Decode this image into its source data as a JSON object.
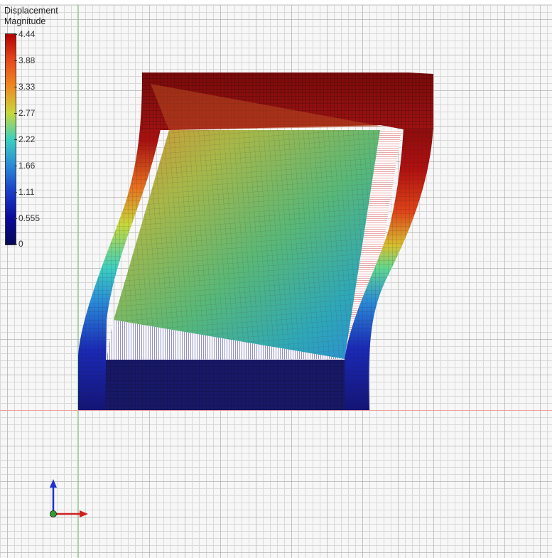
{
  "legend": {
    "title_line1": "Displacement",
    "title_line2": "Magnitude",
    "ticks": [
      "4.44",
      "3.88",
      "3.33",
      "2.77",
      "2.22",
      "1.66",
      "1.11",
      "0.555",
      "0"
    ],
    "colors": [
      "#b40000",
      "#e64a1a",
      "#f08a20",
      "#c8d83a",
      "#3cd0c0",
      "#2a8ad8",
      "#1a3cc8",
      "#0a0a9a",
      "#08085a"
    ]
  },
  "axes": {
    "x_axis_color": "#e04040",
    "y_axis_color": "#3040e0",
    "z_axis_color": "#30a030"
  },
  "icons": {
    "triad": "xyz-triad-icon"
  }
}
